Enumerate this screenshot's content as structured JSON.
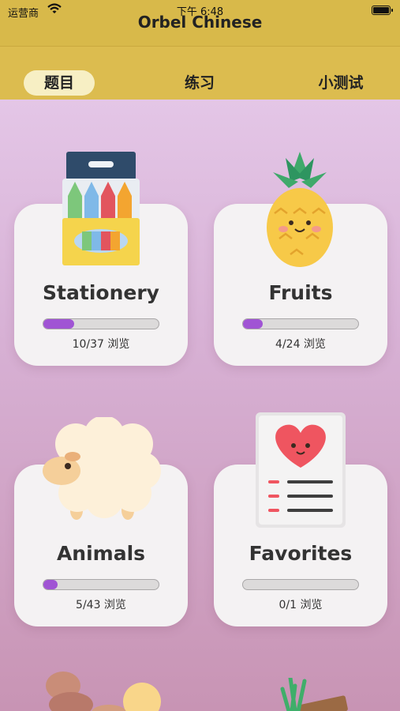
{
  "status": {
    "carrier": "运营商",
    "time": "下午 6:48"
  },
  "app": {
    "title": "Orbel Chinese"
  },
  "tabs": [
    {
      "label": "题目",
      "active": true
    },
    {
      "label": "练习",
      "active": false
    },
    {
      "label": "小测试",
      "active": false
    }
  ],
  "categories": [
    {
      "title": "Stationery",
      "progress_text": "10/37 浏览",
      "progress": 0.27,
      "icon": "crayons-icon"
    },
    {
      "title": "Fruits",
      "progress_text": "4/24 浏览",
      "progress": 0.17,
      "icon": "pineapple-icon"
    },
    {
      "title": "Animals",
      "progress_text": "5/43 浏览",
      "progress": 0.12,
      "icon": "sheep-icon"
    },
    {
      "title": "Favorites",
      "progress_text": "0/1 浏览",
      "progress": 0.0,
      "icon": "heart-list-icon"
    }
  ],
  "colors": {
    "header": "#d8b94a",
    "progress": "#a054d4"
  }
}
